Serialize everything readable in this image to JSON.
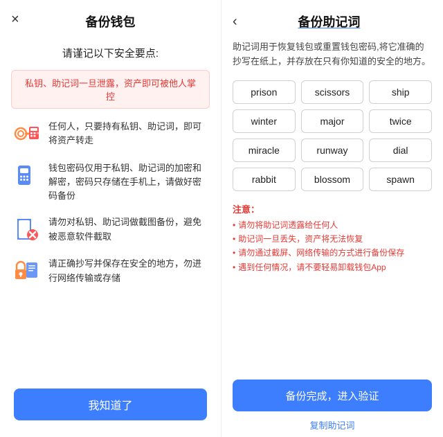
{
  "left": {
    "close_icon": "×",
    "title": "备份钱包",
    "subtitle": "请谨记以下安全要点:",
    "warning": "私钥、助记词一旦泄露，资产即可被他人掌控",
    "security_items": [
      {
        "icon": "key-transfer-icon",
        "text": "任何人，只要持有私钥、助记词，即可将资产转走"
      },
      {
        "icon": "password-icon",
        "text": "钱包密码仅用于私钥、助记词的加密和解密，密码只存储在手机上，请做好密码备份"
      },
      {
        "icon": "screenshot-icon",
        "text": "请勿对私钥、助记词做截图备份，避免被恶意软件截取"
      },
      {
        "icon": "paper-icon",
        "text": "请正确抄写并保存在安全的地方，勿进行网络传输或存储"
      }
    ],
    "know_button": "我知道了"
  },
  "right": {
    "back_icon": "‹",
    "title": "备份助记词",
    "description": "助记词用于恢复钱包或重置钱包密码,将它准确的抄写在纸上，并存放在只有你知道的安全的地方。",
    "words": [
      "prison",
      "scissors",
      "ship",
      "winter",
      "major",
      "twice",
      "miracle",
      "runway",
      "dial",
      "rabbit",
      "blossom",
      "spawn"
    ],
    "notice_title": "注意：",
    "notice_items": [
      "请勿将助记词透露给任何人",
      "助记词一旦丢失，资产将无法恢复",
      "请勿通过截屏、网络传输的方式进行备份保存",
      "遇到任何情况，请不要轻易卸载钱包App"
    ],
    "backup_button": "备份完成，进入验证",
    "copy_link": "复制助记词"
  }
}
